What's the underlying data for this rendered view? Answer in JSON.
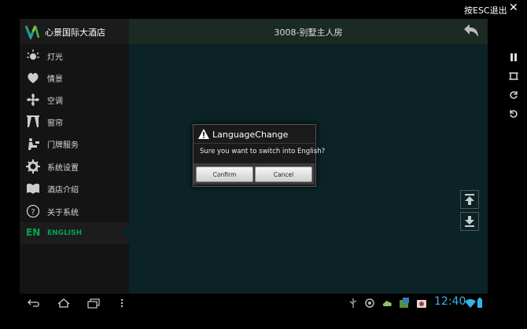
{
  "emulator": {
    "esc_hint": "按ESC退出",
    "close_icon": "close-icon",
    "side_controls": [
      "pause-icon",
      "screenshot-icon",
      "rotate-right-icon",
      "rotate-left-icon"
    ]
  },
  "app": {
    "brand_name": "心景国际大酒店",
    "room_title": "3008-别墅主人房"
  },
  "sidebar": {
    "items": [
      {
        "label": "灯光",
        "icon": "light-icon"
      },
      {
        "label": "情景",
        "icon": "scene-icon"
      },
      {
        "label": "空调",
        "icon": "fan-icon"
      },
      {
        "label": "窗帘",
        "icon": "curtain-icon"
      },
      {
        "label": "门牌服务",
        "icon": "doorplate-service-icon"
      },
      {
        "label": "系统设置",
        "icon": "settings-icon"
      },
      {
        "label": "酒店介绍",
        "icon": "book-icon"
      },
      {
        "label": "关于系统",
        "icon": "help-icon"
      }
    ],
    "lang_code": "EN",
    "lang_label": "ENGLISH"
  },
  "dialog": {
    "title": "LanguageChange",
    "message": "Sure you want to switch into English?",
    "confirm_label": "Confirm",
    "cancel_label": "Cancel"
  },
  "system_bar": {
    "clock": "12:40",
    "accent": "#33b5e5"
  }
}
